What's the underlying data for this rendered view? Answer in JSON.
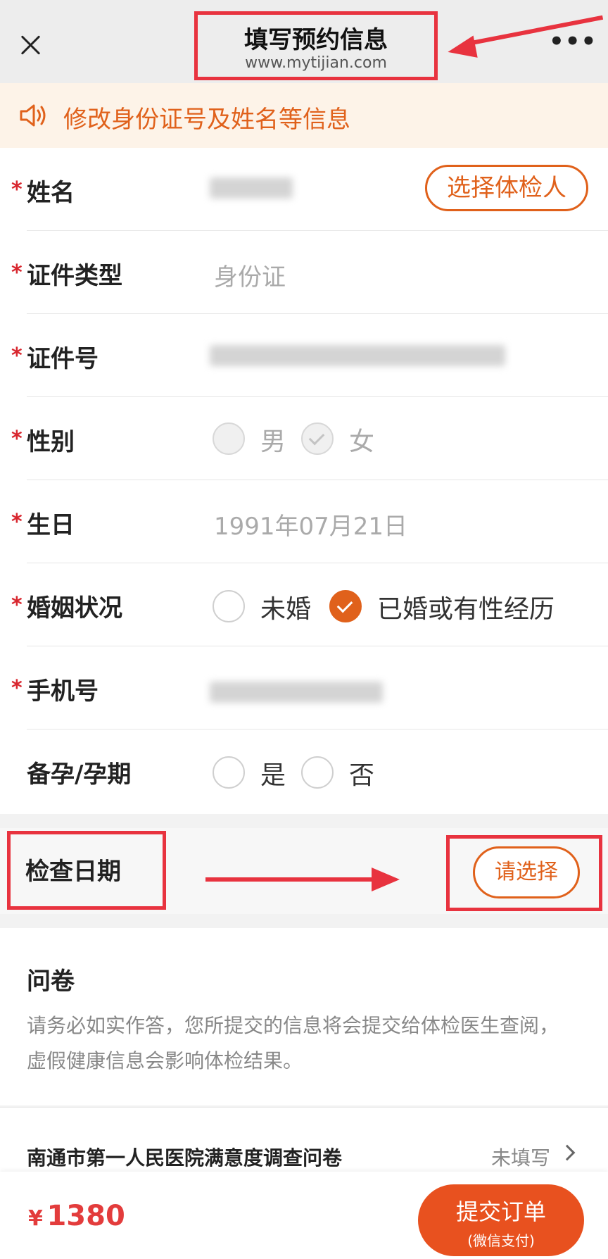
{
  "header": {
    "title": "填写预约信息",
    "subtitle": "www.mytijian.com",
    "more": "•••"
  },
  "notice": {
    "text": "修改身份证号及姓名等信息"
  },
  "form": {
    "required_mark": "*",
    "name": {
      "label": "姓名",
      "button": "选择体检人"
    },
    "id_type": {
      "label": "证件类型",
      "value": "身份证"
    },
    "id_number": {
      "label": "证件号"
    },
    "gender": {
      "label": "性别",
      "options": [
        "男",
        "女"
      ],
      "selected": "女"
    },
    "birthday": {
      "label": "生日",
      "value": "1991年07月21日"
    },
    "marital": {
      "label": "婚姻状况",
      "options": [
        "未婚",
        "已婚或有性经历"
      ],
      "selected": "已婚或有性经历"
    },
    "phone": {
      "label": "手机号"
    },
    "pregnancy": {
      "label": "备孕/孕期",
      "options": [
        "是",
        "否"
      ]
    }
  },
  "exam_date": {
    "label": "检查日期",
    "button": "请选择"
  },
  "questionnaire": {
    "title": "问卷",
    "description": "请务必如实作答，您所提交的信息将会提交给体检医生查阅， 虚假健康信息会影响体检结果。",
    "item_name": "南通市第一人民医院满意度调查问卷",
    "item_status": "未填写"
  },
  "bottom": {
    "currency": "¥",
    "price": "1380",
    "submit": "提交订单",
    "submit_sub": "(微信支付)"
  },
  "colors": {
    "accent": "#e0611b",
    "annotation_red": "#e8333f",
    "price_red": "#e33c3c"
  }
}
